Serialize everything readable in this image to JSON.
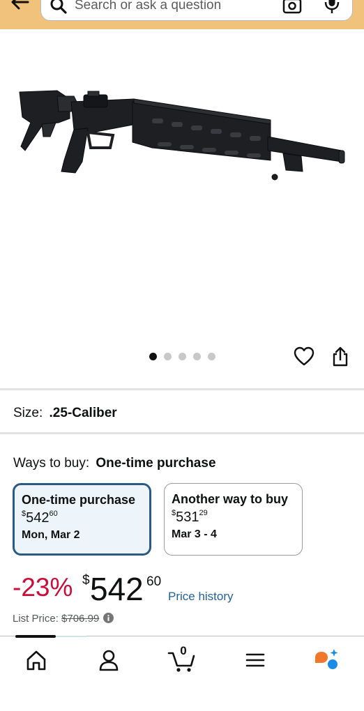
{
  "search": {
    "placeholder": "Search or ask a question"
  },
  "product": {
    "image_alt": "Air rifle",
    "carousel": {
      "count": 5,
      "active_index": 0
    }
  },
  "size": {
    "label": "Size:",
    "value": ".25-Caliber"
  },
  "ways_to_buy": {
    "label": "Ways to buy:",
    "selected": "One-time purchase",
    "options": [
      {
        "title": "One-time purchase",
        "currency": "$",
        "price_whole": "542",
        "price_fraction": "60",
        "date": "Mon, Mar 2",
        "selected": true
      },
      {
        "title": "Another way to buy",
        "currency": "$",
        "price_whole": "531",
        "price_fraction": "29",
        "date": "Mar 3 - 4",
        "selected": false
      }
    ]
  },
  "price": {
    "discount": "-23%",
    "currency": "$",
    "whole": "542",
    "fraction": "60",
    "history_link": "Price history",
    "list_price_label": "List Price:",
    "list_price_value": "$706.99"
  },
  "bottom_nav": {
    "cart_count": "0"
  },
  "colors": {
    "header_bg": "#f0c27b",
    "discount": "#cc0c39",
    "link": "#2162a1",
    "selected_border": "#2b5a85",
    "selected_bg": "#edf5fb",
    "assistant_orange": "#f0772c",
    "assistant_blue": "#1a8ce8"
  },
  "icons": [
    "back-arrow-icon",
    "search-icon",
    "camera-icon",
    "mic-icon",
    "heart-icon",
    "share-icon",
    "info-icon",
    "home-icon",
    "account-icon",
    "cart-icon",
    "menu-icon",
    "assistant-icon"
  ]
}
